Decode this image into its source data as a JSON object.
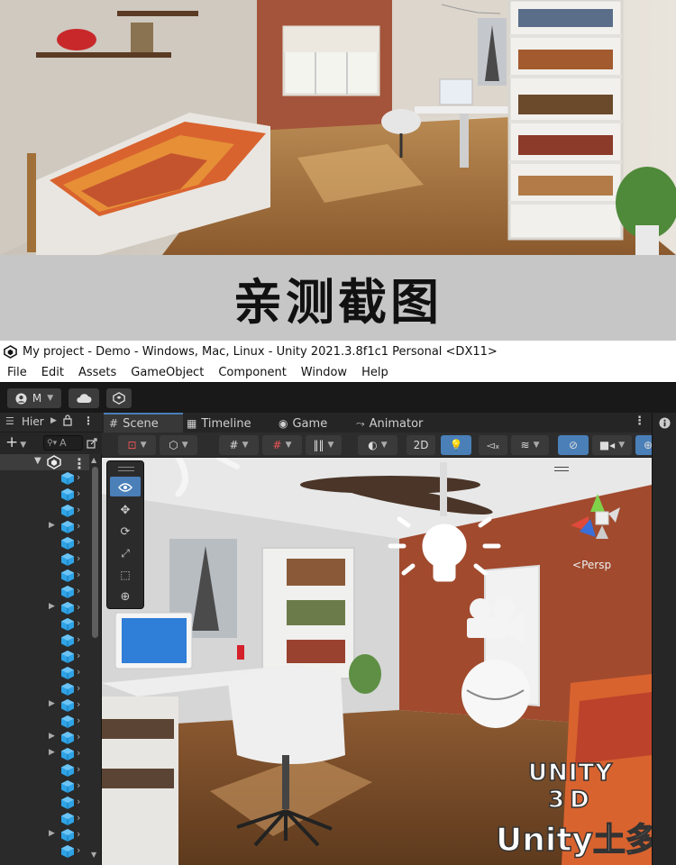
{
  "banner": {
    "text": "亲测截图"
  },
  "window": {
    "title": "My project - Demo - Windows, Mac, Linux - Unity 2021.3.8f1c1 Personal <DX11>"
  },
  "menu": {
    "items": [
      "File",
      "Edit",
      "Assets",
      "GameObject",
      "Component",
      "Window",
      "Help"
    ]
  },
  "toolbar": {
    "account_label": "M"
  },
  "hierarchy": {
    "tab_label": "Hier",
    "search_placeholder": "A",
    "row_count": 24
  },
  "tabs": [
    {
      "label": "Scene",
      "icon": "hash-icon"
    },
    {
      "label": "Timeline",
      "icon": "film-icon"
    },
    {
      "label": "Game",
      "icon": "gamepad-icon"
    },
    {
      "label": "Animator",
      "icon": "animator-icon"
    }
  ],
  "scene_toolbar": {
    "mode_2d": "2D"
  },
  "viewport": {
    "projection_label": "Persp"
  },
  "watermark": {
    "line1": "UNITY",
    "line2": "3D",
    "line3": "Unity土多"
  },
  "colors": {
    "accent": "#2fa3e6",
    "editor_bg": "#282828",
    "active_button": "#4a7fb8"
  }
}
